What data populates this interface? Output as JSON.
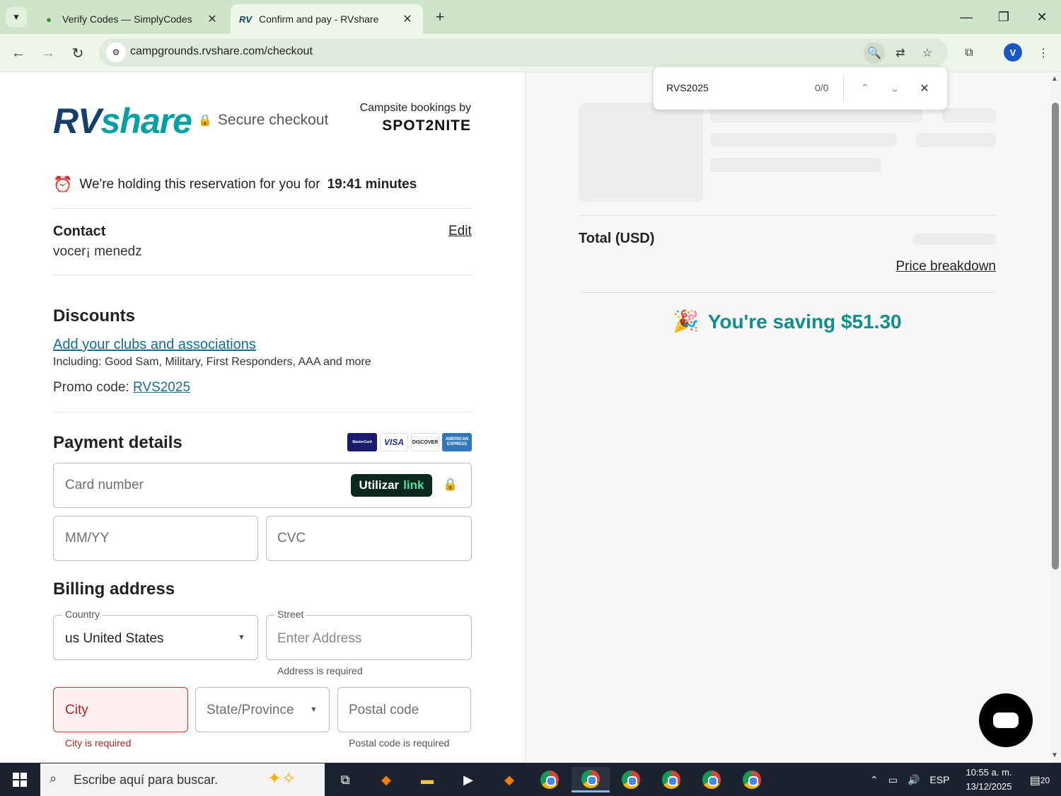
{
  "browser": {
    "tabs": [
      {
        "title": "Verify Codes — SimplyCodes",
        "active": false
      },
      {
        "title": "Confirm and pay - RVshare",
        "active": true
      }
    ],
    "url": "campgrounds.rvshare.com/checkout",
    "profile_initial": "V",
    "find": {
      "query": "RVS2025",
      "count": "0/0"
    }
  },
  "header": {
    "logo_rv": "RV",
    "logo_share": "share",
    "secure_checkout": "Secure checkout",
    "campsite_by": "Campsite bookings by",
    "partner": "SPOT2NITE"
  },
  "hold": {
    "text": "We're holding this reservation for you for",
    "time": "19:41 minutes"
  },
  "contact": {
    "heading": "Contact",
    "edit": "Edit",
    "name": "vocer¡ menedz"
  },
  "discounts": {
    "heading": "Discounts",
    "clubs_link": "Add your clubs and associations",
    "including": "Including: Good Sam, Military, First Responders, AAA and more",
    "promo_label": "Promo code:",
    "promo_code": "RVS2025"
  },
  "payment": {
    "heading": "Payment details",
    "card_number_placeholder": "Card number",
    "utilizar": "Utilizar",
    "link_word": "link",
    "expiry_placeholder": "MM/YY",
    "cvc_placeholder": "CVC",
    "card_brands": [
      "MasterCard",
      "VISA",
      "DISCOVER",
      "AMERICAN EXPRESS"
    ]
  },
  "billing": {
    "heading": "Billing address",
    "country_label": "Country",
    "country_value": "us United States",
    "street_label": "Street",
    "street_placeholder": "Enter Address",
    "address_error": "Address is required",
    "city_placeholder": "City",
    "city_error": "City is required",
    "state_placeholder": "State/Province",
    "postal_placeholder": "Postal code",
    "postal_error": "Postal code is required"
  },
  "summary": {
    "total_label": "Total (USD)",
    "price_breakdown": "Price breakdown",
    "saving": "You're saving $51.30"
  },
  "taskbar": {
    "search_placeholder": "Escribe aquí para buscar.",
    "language": "ESP",
    "time": "10:55 a. m.",
    "date": "13/12/2025",
    "notifications": "20"
  },
  "colors": {
    "accent_teal": "#00a1a4",
    "error_red": "#b3261e",
    "link_blue": "#1a6a91"
  }
}
